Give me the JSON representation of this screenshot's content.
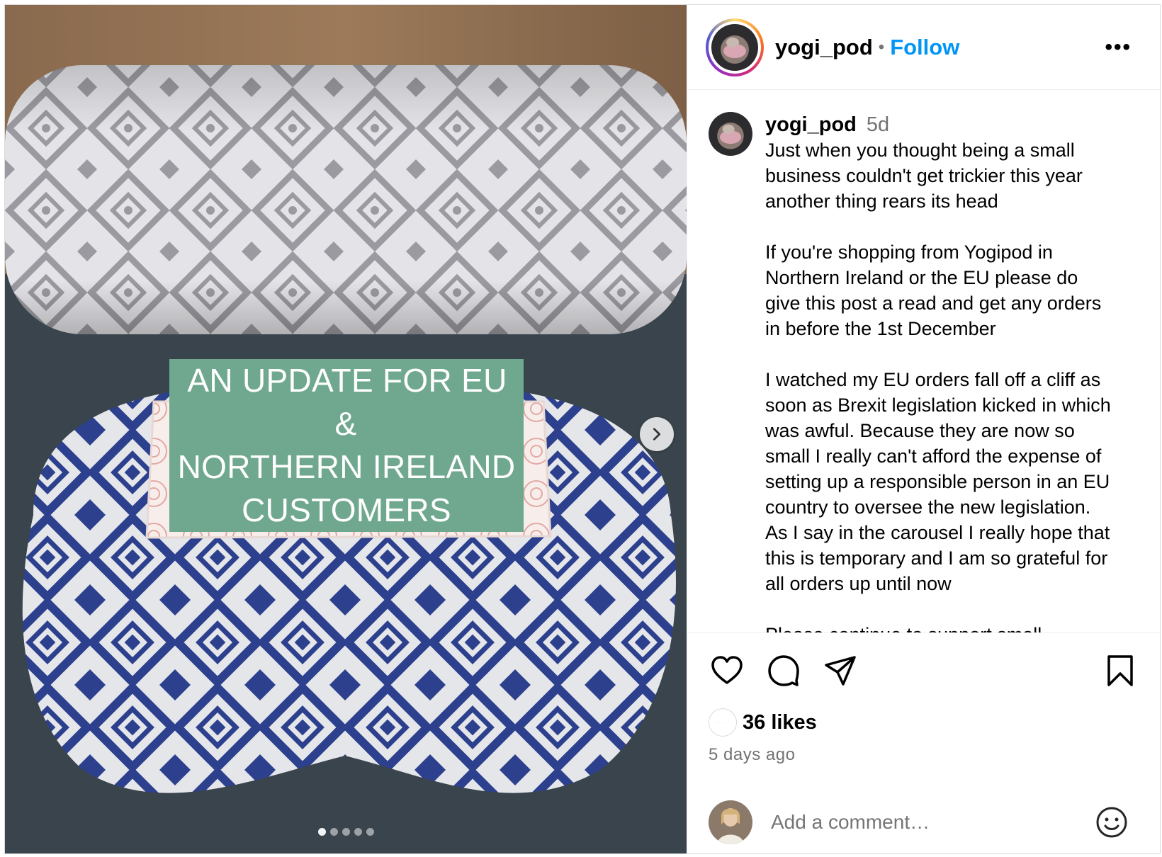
{
  "post": {
    "overlay_lines": [
      "AN UPDATE FOR EU &",
      "NORTHERN IRELAND",
      "CUSTOMERS"
    ],
    "carousel": {
      "count": 5,
      "active_index": 0
    }
  },
  "header": {
    "username": "yogi_pod",
    "separator": "•",
    "follow_label": "Follow",
    "more_label": "•••"
  },
  "caption": {
    "username": "yogi_pod",
    "time": "5d",
    "paragraphs": [
      [
        "Just when you thought being a small",
        "business couldn't get trickier this year",
        "another thing rears its head"
      ],
      [
        "If you're shopping from Yogipod in",
        "Northern Ireland or the EU please do",
        "give this post a read and get any orders",
        "in before the 1st December"
      ],
      [
        "I watched my EU orders fall off a cliff as",
        "soon as Brexit legislation kicked in which",
        "was awful. Because they are now so",
        "small I really can't afford the expense of",
        "setting up a responsible person in an EU",
        "country to oversee the new legislation.",
        "As I say in the carousel I really hope that",
        "this is temporary and I am so grateful for",
        "all orders up until now"
      ],
      [
        "Please continue to support small"
      ]
    ]
  },
  "engagement": {
    "likes": "36 likes",
    "time_ago": "5 days ago",
    "icons": [
      "heart-icon",
      "comment-icon",
      "share-icon",
      "bookmark-icon"
    ]
  },
  "comment": {
    "placeholder": "Add a comment…"
  },
  "colors": {
    "follow": "#0095f6",
    "overlay_bg": "#6fa88f",
    "muted": "#737373"
  }
}
